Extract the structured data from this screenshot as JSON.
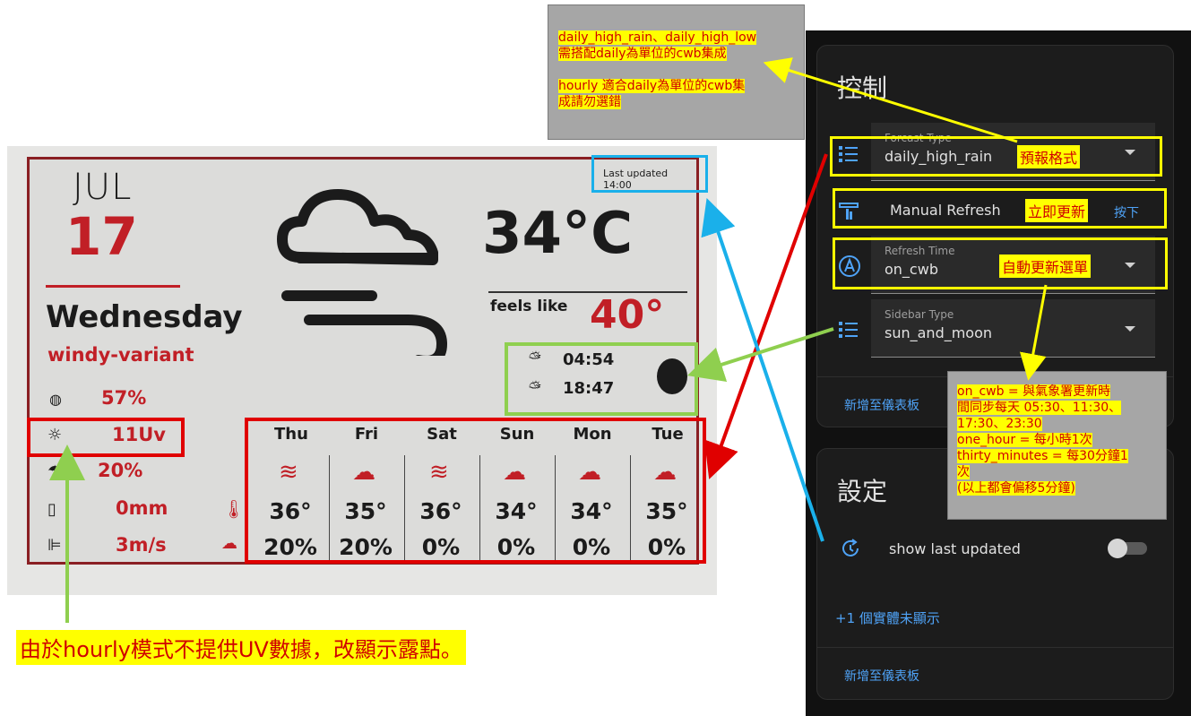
{
  "note_top": {
    "line1": "daily_high_rain、daily_high_low",
    "line2": "需搭配daily為單位的cwb集成",
    "line3": "hourly 適合daily為單位的cwb集",
    "line4": "成請勿選錯"
  },
  "display": {
    "last_updated": "Last updated 14:00",
    "month": "JUL",
    "day": "17",
    "weekday": "Wednesday",
    "condition": "windy-variant",
    "temperature": "34°C",
    "feels_like_label": "feels like",
    "feels_like_value": "40°",
    "sunrise": "04:54",
    "sunset": "18:47",
    "humidity": "57%",
    "uv": "11Uv",
    "rain_chance": "20%",
    "rain_amount": "0mm",
    "wind": "3m/s",
    "forecast": [
      {
        "day": "Thu",
        "icon": "windy-icon",
        "temp": "36°",
        "rain": "20%"
      },
      {
        "day": "Fri",
        "icon": "cloud-wind-icon",
        "temp": "35°",
        "rain": "20%"
      },
      {
        "day": "Sat",
        "icon": "windy-icon",
        "temp": "36°",
        "rain": "0%"
      },
      {
        "day": "Sun",
        "icon": "cloud-drop-icon",
        "temp": "34°",
        "rain": "0%"
      },
      {
        "day": "Mon",
        "icon": "cloud-drop-icon",
        "temp": "34°",
        "rain": "0%"
      },
      {
        "day": "Tue",
        "icon": "cloud-drop-icon",
        "temp": "35°",
        "rain": "0%"
      }
    ]
  },
  "annotations": {
    "forecast_type": "預報格式",
    "manual_refresh": "立即更新",
    "refresh_time": "自動更新選單",
    "hourly_note": "由於hourly模式不提供UV數據，改顯示露點。",
    "refresh_note": {
      "l1": "on_cwb = 與氣象署更新時",
      "l2": "間同步每天 05:30、11:30、",
      "l3": "17:30、23:30",
      "l4": "one_hour = 每小時1次",
      "l5": "thirty_minutes = 每30分鐘1",
      "l6": "次",
      "l7": "(以上都會偏移5分鐘)"
    }
  },
  "control_card": {
    "title": "控制",
    "forecast_type": {
      "label": "Forcast Type",
      "value": "daily_high_rain"
    },
    "manual_refresh": {
      "label": "Manual Refresh",
      "action": "按下"
    },
    "refresh_time": {
      "label": "Refresh Time",
      "value": "on_cwb"
    },
    "sidebar_type": {
      "label": "Sidebar Type",
      "value": "sun_and_moon"
    },
    "add_to_dashboard": "新增至儀表板"
  },
  "settings_card": {
    "title": "設定",
    "show_last_updated": "show last updated",
    "hidden_entities": "+1 個實體未顯示",
    "add_to_dashboard": "新增至儀表板"
  },
  "colors": {
    "epaper_red": "#c11f26",
    "annotation_red": "#e00000",
    "annotation_yellow": "#ffff00",
    "annotation_blue": "#1ab0ea",
    "annotation_green": "#8fcf4f",
    "ha_background": "#111111",
    "ha_link": "#4fa3f7"
  }
}
